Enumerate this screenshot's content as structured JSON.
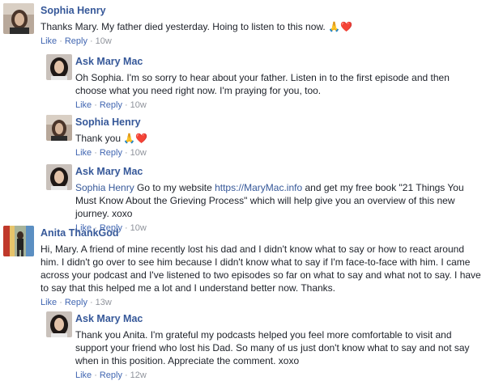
{
  "comments": [
    {
      "author": "Sophia Henry",
      "text": "Thanks Mary. My father died yesterday. Hoing to listen to this now.",
      "emoji": [
        "🙏",
        "❤️"
      ],
      "like": "Like",
      "reply": "Reply",
      "dot": "·",
      "time": "10w"
    },
    {
      "author": "Ask Mary Mac",
      "text": "Oh Sophia. I'm so sorry to hear about your father. Listen in to the first episode and then choose what you need right now. I'm praying for you, too.",
      "like": "Like",
      "reply": "Reply",
      "dot": "·",
      "time": "10w"
    },
    {
      "author": "Sophia Henry",
      "text": "Thank you",
      "emoji": [
        "🙏",
        "❤️"
      ],
      "like": "Like",
      "reply": "Reply",
      "dot": "·",
      "time": "10w"
    },
    {
      "author": "Ask Mary Mac",
      "mention": "Sophia Henry",
      "text_before_link": " Go to my website ",
      "link": "https://MaryMac.info",
      "text_after_link": " and get my free book \"21 Things You Must Know About the Grieving Process\" which will help give you an overview of this new journey. xoxo",
      "like": "Like",
      "reply": "Reply",
      "dot": "·",
      "time": "10w"
    },
    {
      "author": "Anita ThankGod",
      "text": "Hi, Mary. A friend of mine recently lost his dad and I didn't know what to say or how to react around him. I didn't go over to see him because I didn't know what to say if I'm face-to-face with him. I came across your podcast and I've listened to two episodes so far on what to say and what not to say. I have to say that this helped me a lot and I understand better now. Thanks.",
      "like": "Like",
      "reply": "Reply",
      "dot": "·",
      "time": "13w"
    },
    {
      "author": "Ask Mary Mac",
      "text": "Thank you Anita. I'm grateful my podcasts helped you feel more comfortable to visit and support your friend who lost his Dad. So many of us just don't know what to say and not say when in this position. Appreciate the comment. xoxo",
      "like": "Like",
      "reply": "Reply",
      "dot": "·",
      "time": "12w"
    }
  ],
  "colors": {
    "author_name": "#365899",
    "action_link": "#4267b2",
    "meta_gray": "#90949c",
    "body_text": "#1d2129"
  }
}
